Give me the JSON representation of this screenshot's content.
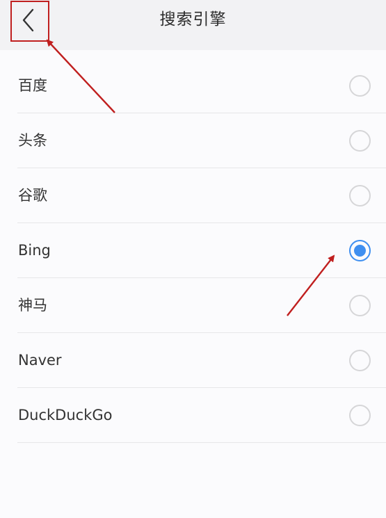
{
  "header": {
    "title": "搜索引擎",
    "back_icon": "chevron-left-icon"
  },
  "engines": [
    {
      "label": "百度",
      "selected": false
    },
    {
      "label": "头条",
      "selected": false
    },
    {
      "label": "谷歌",
      "selected": false
    },
    {
      "label": "Bing",
      "selected": true
    },
    {
      "label": "神马",
      "selected": false
    },
    {
      "label": "Naver",
      "selected": false
    },
    {
      "label": "DuckDuckGo",
      "selected": false
    }
  ],
  "colors": {
    "accent": "#3f8ff0",
    "annotation": "#c01f1f",
    "header_bg": "#f2f2f4",
    "page_bg": "#fbfbfd"
  }
}
